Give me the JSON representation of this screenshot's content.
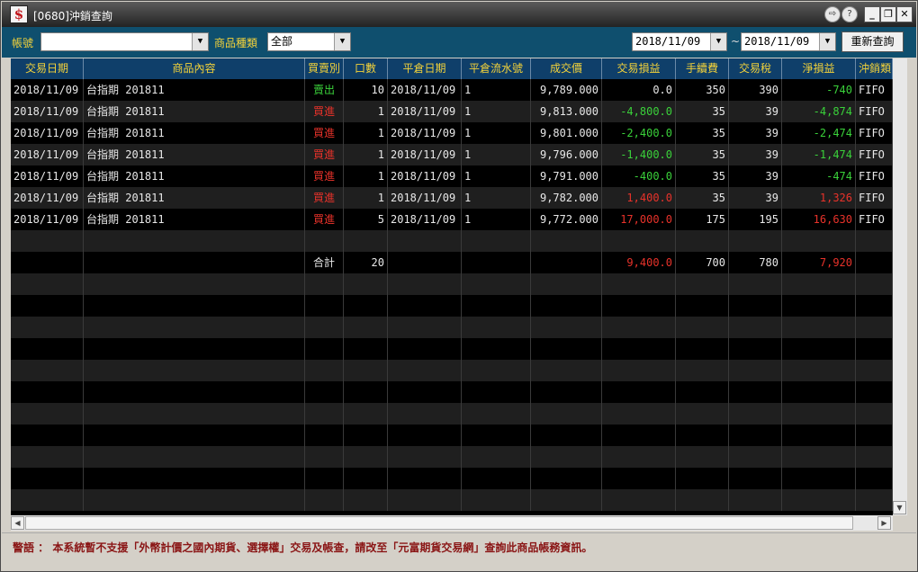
{
  "window": {
    "title": "[0680]沖銷查詢",
    "icon_glyph": "$",
    "buttons": {
      "help1": "⇨",
      "help2": "?",
      "minimize": "_",
      "restore": "❐",
      "close": "✕"
    }
  },
  "toolbar": {
    "account_label": "帳號",
    "account_value": "",
    "product_type_label": "商品種類",
    "product_type_value": "全部",
    "date_from": "2018/11/09",
    "date_sep": "~",
    "date_to": "2018/11/09",
    "requery_label": "重新查詢"
  },
  "table": {
    "headers": [
      "交易日期",
      "商品內容",
      "買賣別",
      "口數",
      "平倉日期",
      "平倉流水號",
      "成交價",
      "交易損益",
      "手續費",
      "交易稅",
      "淨損益",
      "沖銷類"
    ],
    "rows": [
      {
        "date": "2018/11/09",
        "product": "台指期 201811",
        "side": "賣出",
        "qty": "10",
        "close_date": "2018/11/09",
        "serial": "1",
        "price": "9,789.000",
        "pl": "0.0",
        "fee": "350",
        "tax": "390",
        "net": "-740",
        "method": "FIFO"
      },
      {
        "date": "2018/11/09",
        "product": "台指期 201811",
        "side": "買進",
        "qty": "1",
        "close_date": "2018/11/09",
        "serial": "1",
        "price": "9,813.000",
        "pl": "-4,800.0",
        "fee": "35",
        "tax": "39",
        "net": "-4,874",
        "method": "FIFO"
      },
      {
        "date": "2018/11/09",
        "product": "台指期 201811",
        "side": "買進",
        "qty": "1",
        "close_date": "2018/11/09",
        "serial": "1",
        "price": "9,801.000",
        "pl": "-2,400.0",
        "fee": "35",
        "tax": "39",
        "net": "-2,474",
        "method": "FIFO"
      },
      {
        "date": "2018/11/09",
        "product": "台指期 201811",
        "side": "買進",
        "qty": "1",
        "close_date": "2018/11/09",
        "serial": "1",
        "price": "9,796.000",
        "pl": "-1,400.0",
        "fee": "35",
        "tax": "39",
        "net": "-1,474",
        "method": "FIFO"
      },
      {
        "date": "2018/11/09",
        "product": "台指期 201811",
        "side": "買進",
        "qty": "1",
        "close_date": "2018/11/09",
        "serial": "1",
        "price": "9,791.000",
        "pl": "-400.0",
        "fee": "35",
        "tax": "39",
        "net": "-474",
        "method": "FIFO"
      },
      {
        "date": "2018/11/09",
        "product": "台指期 201811",
        "side": "買進",
        "qty": "1",
        "close_date": "2018/11/09",
        "serial": "1",
        "price": "9,782.000",
        "pl": "1,400.0",
        "fee": "35",
        "tax": "39",
        "net": "1,326",
        "method": "FIFO"
      },
      {
        "date": "2018/11/09",
        "product": "台指期 201811",
        "side": "買進",
        "qty": "5",
        "close_date": "2018/11/09",
        "serial": "1",
        "price": "9,772.000",
        "pl": "17,000.0",
        "fee": "175",
        "tax": "195",
        "net": "16,630",
        "method": "FIFO"
      }
    ],
    "summary": {
      "label": "合計",
      "qty": "20",
      "pl": "9,400.0",
      "fee": "700",
      "tax": "780",
      "net": "7,920"
    }
  },
  "warning": "警語 ： 本系統暫不支援「外幣計價之國內期貨、選擇權」交易及帳查，請改至「元富期貨交易網」查詢此商品帳務資訊。",
  "colors": {
    "header_bg": "#0f3f6a",
    "header_text": "#f3d23a",
    "positive": "#e8322a",
    "negative": "#3ad13a",
    "toolbar_bg": "#0f4f6e"
  }
}
